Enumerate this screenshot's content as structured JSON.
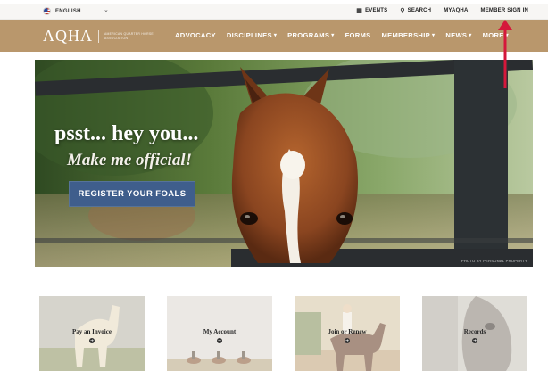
{
  "utility": {
    "language": "ENGLISH",
    "links": [
      {
        "label": "EVENTS",
        "icon": "calendar-icon",
        "glyph": "▦"
      },
      {
        "label": "SEARCH",
        "icon": "search-icon",
        "glyph": "⚲"
      },
      {
        "label": "MYAQHA",
        "icon": "",
        "glyph": ""
      },
      {
        "label": "MEMBER SIGN IN",
        "icon": "",
        "glyph": ""
      }
    ]
  },
  "nav": {
    "logo": "AQHA",
    "logo_sub": "AMERICAN QUARTER HORSE ASSOCIATION",
    "items": [
      {
        "label": "ADVOCACY",
        "dropdown": false
      },
      {
        "label": "DISCIPLINES",
        "dropdown": true
      },
      {
        "label": "PROGRAMS",
        "dropdown": true
      },
      {
        "label": "FORMS",
        "dropdown": false
      },
      {
        "label": "MEMBERSHIP",
        "dropdown": true
      },
      {
        "label": "NEWS",
        "dropdown": true
      },
      {
        "label": "MORE",
        "dropdown": true
      }
    ]
  },
  "hero": {
    "headline": "psst... hey you...",
    "subline": "Make me official!",
    "cta_label": "REGISTER YOUR FOALS",
    "credit": "PHOTO BY PERSONAL PROPERTY"
  },
  "cards": [
    {
      "label": "Pay an Invoice"
    },
    {
      "label": "My Account"
    },
    {
      "label": "Join or Renew"
    },
    {
      "label": "Records"
    }
  ],
  "colors": {
    "nav_bg": "#b9976c",
    "cta_bg": "#3f5e8c",
    "annotation": "#d5183b"
  }
}
